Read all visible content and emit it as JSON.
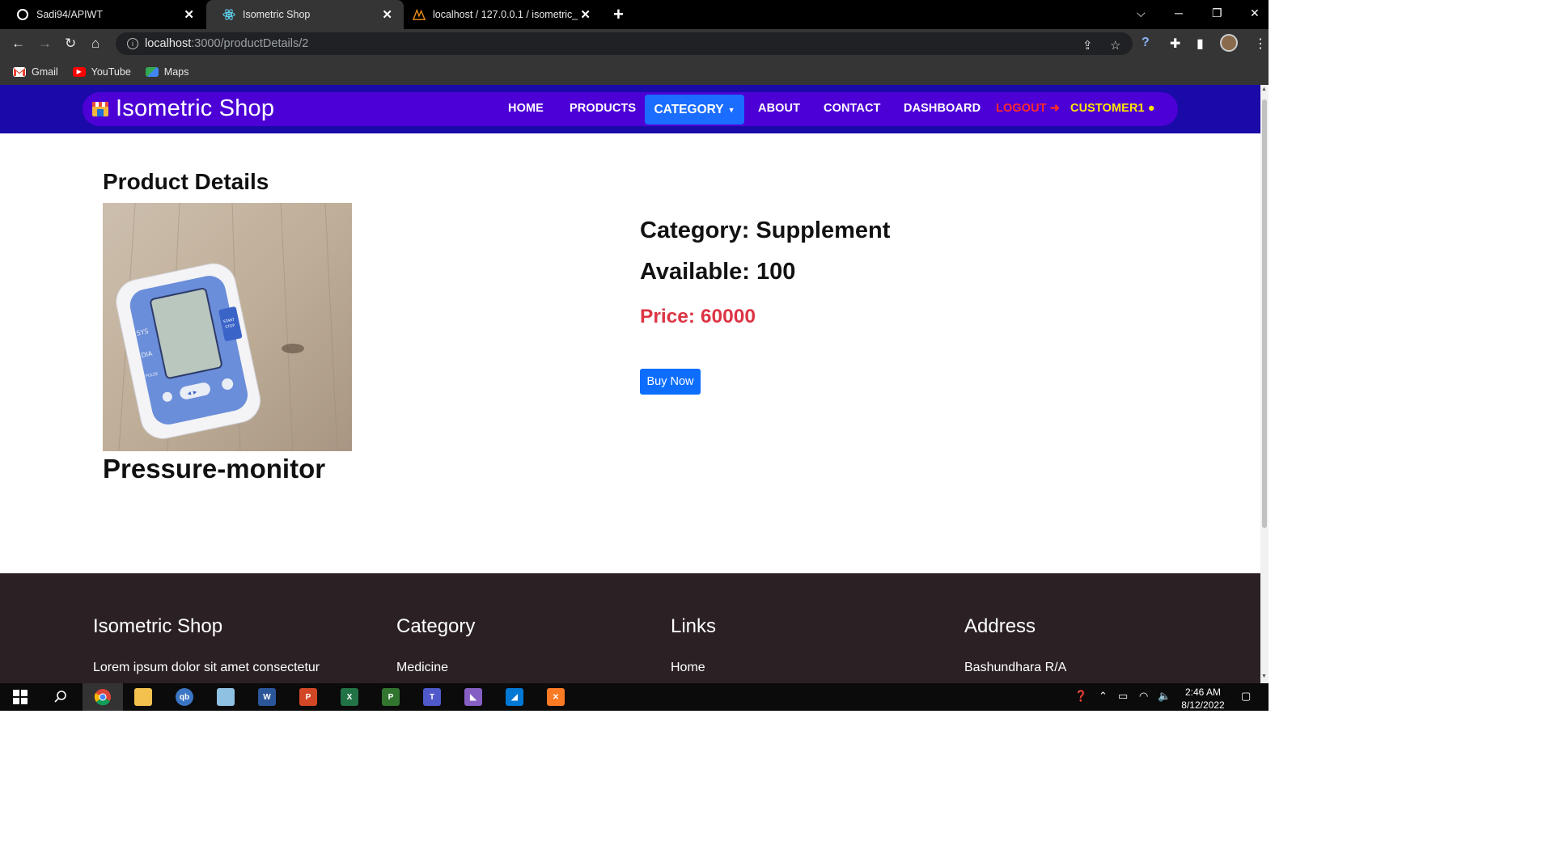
{
  "browser": {
    "tabs": [
      {
        "title": "Sadi94/APIWT",
        "favicon": "github-icon",
        "active": false
      },
      {
        "title": "Isometric Shop",
        "favicon": "react-icon",
        "active": true
      },
      {
        "title": "localhost / 127.0.0.1 / isometric_",
        "favicon": "phpmyadmin-icon",
        "active": false
      }
    ],
    "url_host": "localhost",
    "url_path": ":3000/productDetails/2",
    "bookmarks": [
      {
        "label": "Gmail",
        "icon": "gmail-icon",
        "color": "#ea4335"
      },
      {
        "label": "YouTube",
        "icon": "youtube-icon",
        "color": "#ff0000"
      },
      {
        "label": "Maps",
        "icon": "maps-icon",
        "color": "#34a853"
      }
    ]
  },
  "navbar": {
    "brand": "Isometric Shop",
    "links": {
      "home": "HOME",
      "products": "PRODUCTS",
      "category": "CATEGORY",
      "about": "ABOUT",
      "contact": "CONTACT",
      "dashboard": "DASHBOARD",
      "logout": "LOGOUT",
      "customer": "CUSTOMER1"
    },
    "colors": {
      "strip": "#1a0aa8",
      "pill": "#4d00d6",
      "active": "#1a6dff",
      "logout": "#ff2a2a",
      "customer": "#ffe600"
    }
  },
  "product": {
    "page_title": "Product Details",
    "name": "Pressure-monitor",
    "category_text": "Category: Supplement",
    "available_text": "Available: 100",
    "price_text": "Price: 60000",
    "buy_label": "Buy Now",
    "monitor_labels": {
      "sys": "SYS",
      "dia": "DIA",
      "pulse": "PULSE",
      "start_stop_1": "START",
      "start_stop_2": "STOP"
    }
  },
  "footer": {
    "brand_heading": "Isometric Shop",
    "brand_text": "Lorem ipsum dolor sit amet consectetur",
    "category_heading": "Category",
    "category_first": "Medicine",
    "links_heading": "Links",
    "links_first": "Home",
    "address_heading": "Address",
    "address_first": "Bashundhara R/A"
  },
  "taskbar": {
    "time": "2:46 AM",
    "date": "8/12/2022"
  }
}
